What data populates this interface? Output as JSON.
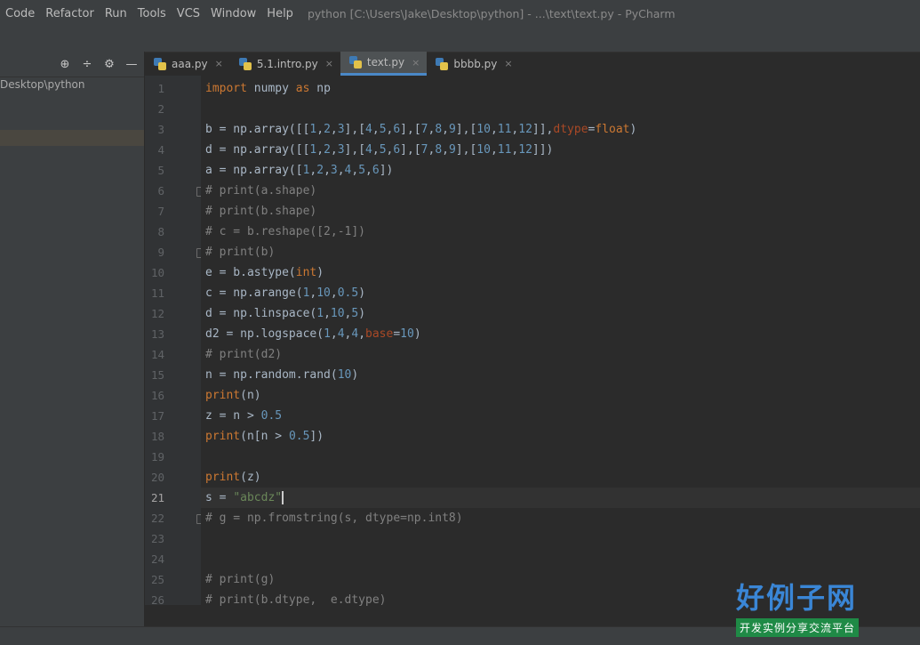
{
  "menu": [
    "Code",
    "Refactor",
    "Run",
    "Tools",
    "VCS",
    "Window",
    "Help"
  ],
  "window_title": "python [C:\\Users\\Jake\\Desktop\\python] - ...\\text\\text.py - PyCharm",
  "sidebar": {
    "tool_icons": [
      "target-icon",
      "collapse-icon",
      "gear-icon",
      "hide-icon"
    ],
    "tool_glyphs": [
      "⊕",
      "÷",
      "⚙",
      "—"
    ],
    "project_path": "Desktop\\python"
  },
  "tabs": [
    {
      "label": "aaa.py",
      "active": false
    },
    {
      "label": "5.1.intro.py",
      "active": false
    },
    {
      "label": "text.py",
      "active": true
    },
    {
      "label": "bbbb.py",
      "active": false
    }
  ],
  "tab_close": "×",
  "code": [
    "import numpy as np",
    "",
    "b = np.array([[1,2,3],[4,5,6],[7,8,9],[10,11,12]],dtype=float)",
    "d = np.array([[1,2,3],[4,5,6],[7,8,9],[10,11,12]])",
    "a = np.array([1,2,3,4,5,6])",
    "# print(a.shape)",
    "# print(b.shape)",
    "# c = b.reshape([2,-1])",
    "# print(b)",
    "e = b.astype(int)",
    "c = np.arange(1,10,0.5)",
    "d = np.linspace(1,10,5)",
    "d2 = np.logspace(1,4,4,base=10)",
    "# print(d2)",
    "n = np.random.rand(10)",
    "print(n)",
    "z = n > 0.5",
    "print(n[n > 0.5])",
    "",
    "print(z)",
    "s = \"abcdz\"",
    "# g = np.fromstring(s, dtype=np.int8)",
    "",
    "",
    "# print(g)",
    "# print(b.dtype,  e.dtype)"
  ],
  "line_numbers": [
    "1",
    "2",
    "3",
    "4",
    "5",
    "6",
    "7",
    "8",
    "9",
    "10",
    "11",
    "12",
    "13",
    "14",
    "15",
    "16",
    "17",
    "18",
    "19",
    "20",
    "21",
    "22",
    "23",
    "24",
    "25",
    "26"
  ],
  "current_line": "21",
  "watermark": {
    "big": "好例子网",
    "small": "开发实例分享交流平台"
  },
  "colors": {
    "keyword": "#cc7832",
    "number": "#6897bb",
    "comment": "#808080",
    "string": "#6a8759",
    "accent": "#4a88c7"
  }
}
